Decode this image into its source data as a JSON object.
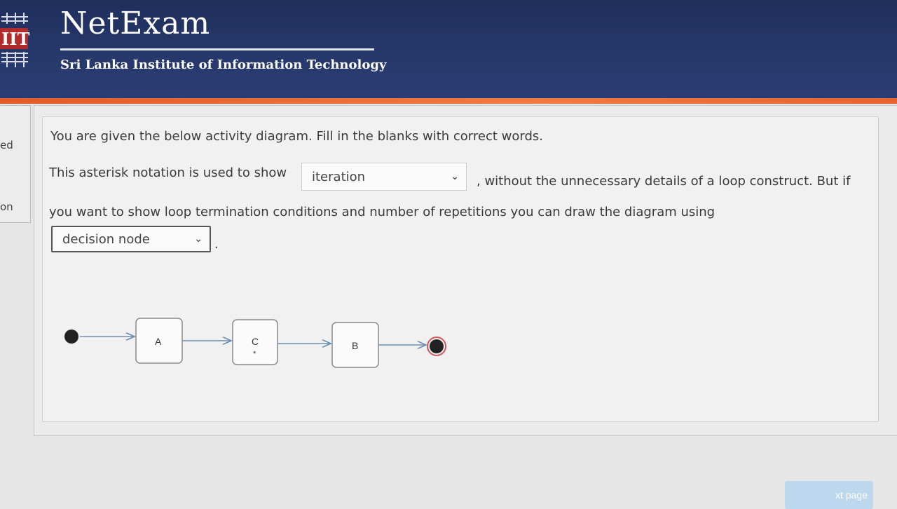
{
  "header": {
    "logo_text": "IIT",
    "title": "NetExam",
    "subtitle": "Sri Lanka Institute of Information Technology"
  },
  "sidebar": {
    "items": [
      {
        "label": "ed"
      },
      {
        "label": "on"
      }
    ]
  },
  "question": {
    "prompt": "You are given the below activity diagram. Fill in the blanks with correct words.",
    "sentence_part1": "This asterisk notation is used to show",
    "blank1_value": "iteration",
    "sentence_part2": ", without the unnecessary details of a loop construct. But if",
    "sentence_part3": "you want to show loop termination conditions and number of repetitions you can draw the diagram using",
    "blank2_value": "decision node",
    "sentence_end": "."
  },
  "diagram": {
    "nodes": [
      "A",
      "C",
      "B"
    ],
    "node_c_marker": "*"
  },
  "footer": {
    "next_label": "xt page"
  },
  "colors": {
    "header_bg": "#26386b",
    "accent_stripe": "#e8642d",
    "button_bg": "#bdd8ee"
  }
}
